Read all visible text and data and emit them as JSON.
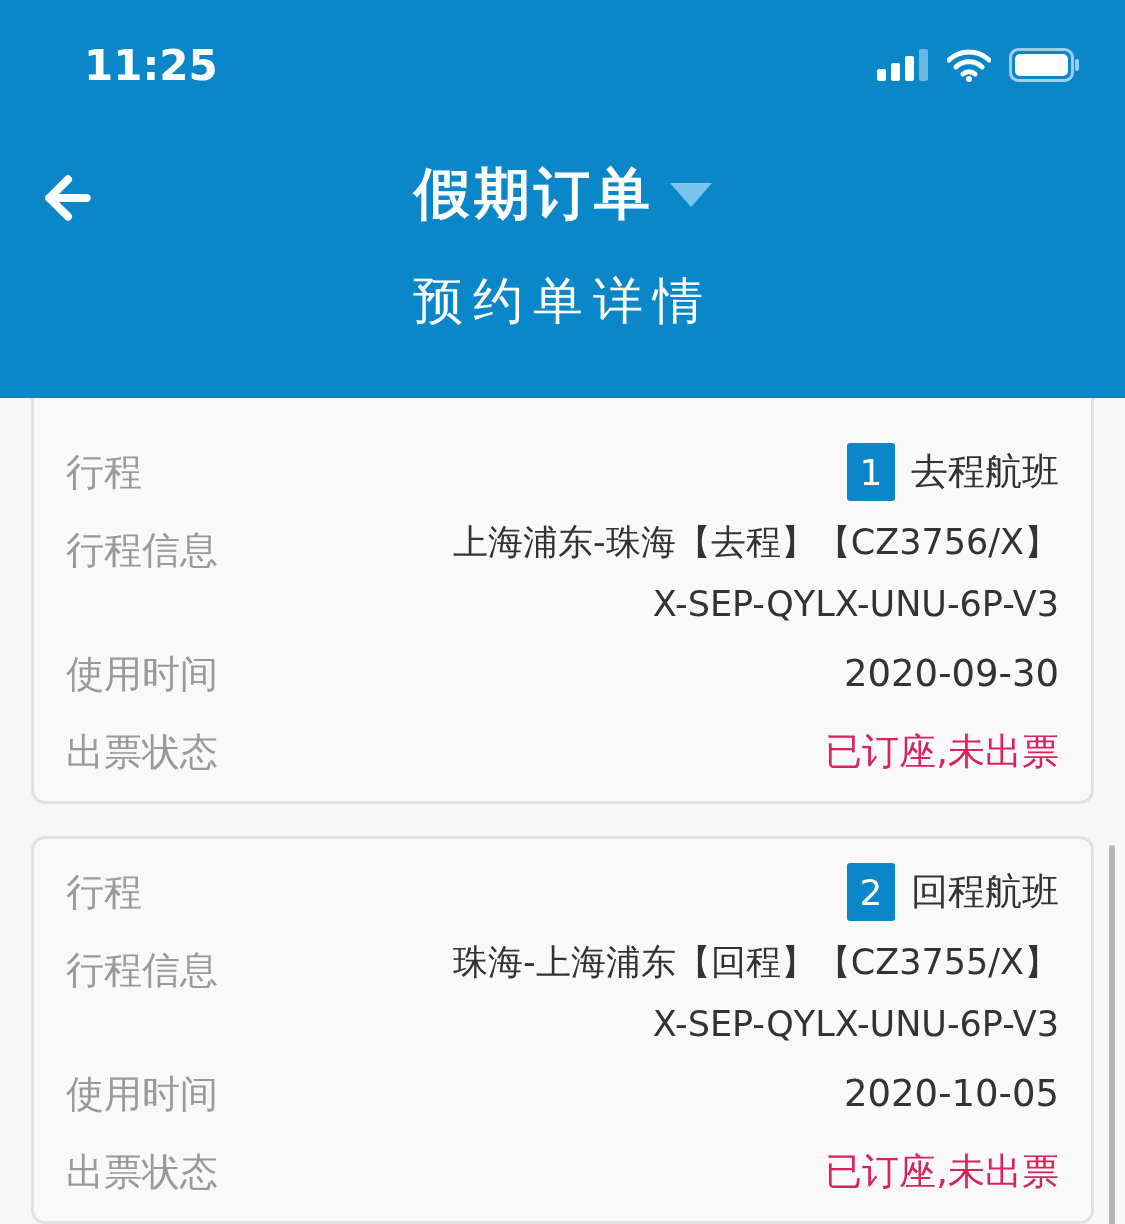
{
  "status_bar": {
    "time": "11:25"
  },
  "nav": {
    "title": "假期订单",
    "subtitle": "预约单详情"
  },
  "trips": [
    {
      "rows": [
        {
          "kind": "badge",
          "label": "行程",
          "number": "1",
          "value": "去程航班"
        },
        {
          "kind": "info",
          "label": "行程信息",
          "lines": [
            "上海浦东-珠海【去程】【CZ3756/X】",
            "X-SEP-QYLX-UNU-6P-V3"
          ]
        },
        {
          "kind": "plain",
          "label": "使用时间",
          "value": "2020-09-30"
        },
        {
          "kind": "status",
          "label": "出票状态",
          "value": "已订座,未出票"
        }
      ]
    },
    {
      "rows": [
        {
          "kind": "badge",
          "label": "行程",
          "number": "2",
          "value": "回程航班"
        },
        {
          "kind": "info",
          "label": "行程信息",
          "lines": [
            "珠海-上海浦东【回程】【CZ3755/X】",
            "X-SEP-QYLX-UNU-6P-V3"
          ]
        },
        {
          "kind": "plain",
          "label": "使用时间",
          "value": "2020-10-05"
        },
        {
          "kind": "status",
          "label": "出票状态",
          "value": "已订座,未出票"
        }
      ]
    }
  ]
}
